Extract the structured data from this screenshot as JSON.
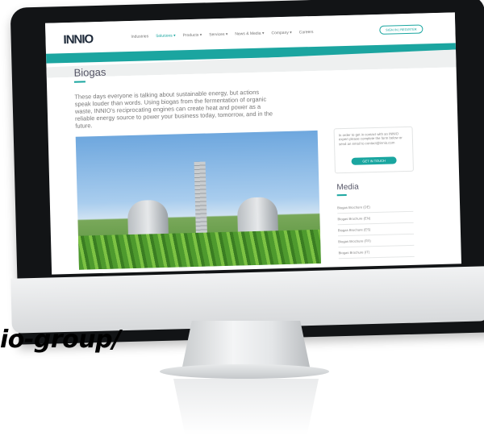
{
  "website": {
    "logo": "INNIO",
    "nav": {
      "items": [
        {
          "label": "Industries"
        },
        {
          "label": "Solutions ▾"
        },
        {
          "label": "Products ▾"
        },
        {
          "label": "Services ▾"
        },
        {
          "label": "News & Media ▾"
        },
        {
          "label": "Company ▾"
        },
        {
          "label": "Careers"
        }
      ],
      "login_label": "SIGN IN | REGISTER"
    },
    "page_title": "Biogas",
    "intro": "These days everyone is talking about sustainable energy, but actions speak louder than words. Using biogas from the fermentation of organic waste, INNIO's reciprocating engines can create heat and power as a reliable energy source to power your business today, tomorrow, and in the future.",
    "sidebar": {
      "contact_text": "In order to get in contact with an INNIO expert please complete the form below or send an email to contact@innio.com",
      "cta_label": "GET IN TOUCH"
    },
    "media": {
      "title": "Media",
      "items": [
        {
          "label": "Biogas Brochure (DE)"
        },
        {
          "label": "Biogas Brochure (EN)"
        },
        {
          "label": "Biogas Brochure (ES)"
        },
        {
          "label": "Biogas Brochure (FR)"
        },
        {
          "label": "Biogas Brochure (IT)"
        }
      ]
    }
  },
  "overlay_text": "io-group/",
  "colors": {
    "accent": "#1aa6a0",
    "monitor_bezel": "#121416"
  }
}
